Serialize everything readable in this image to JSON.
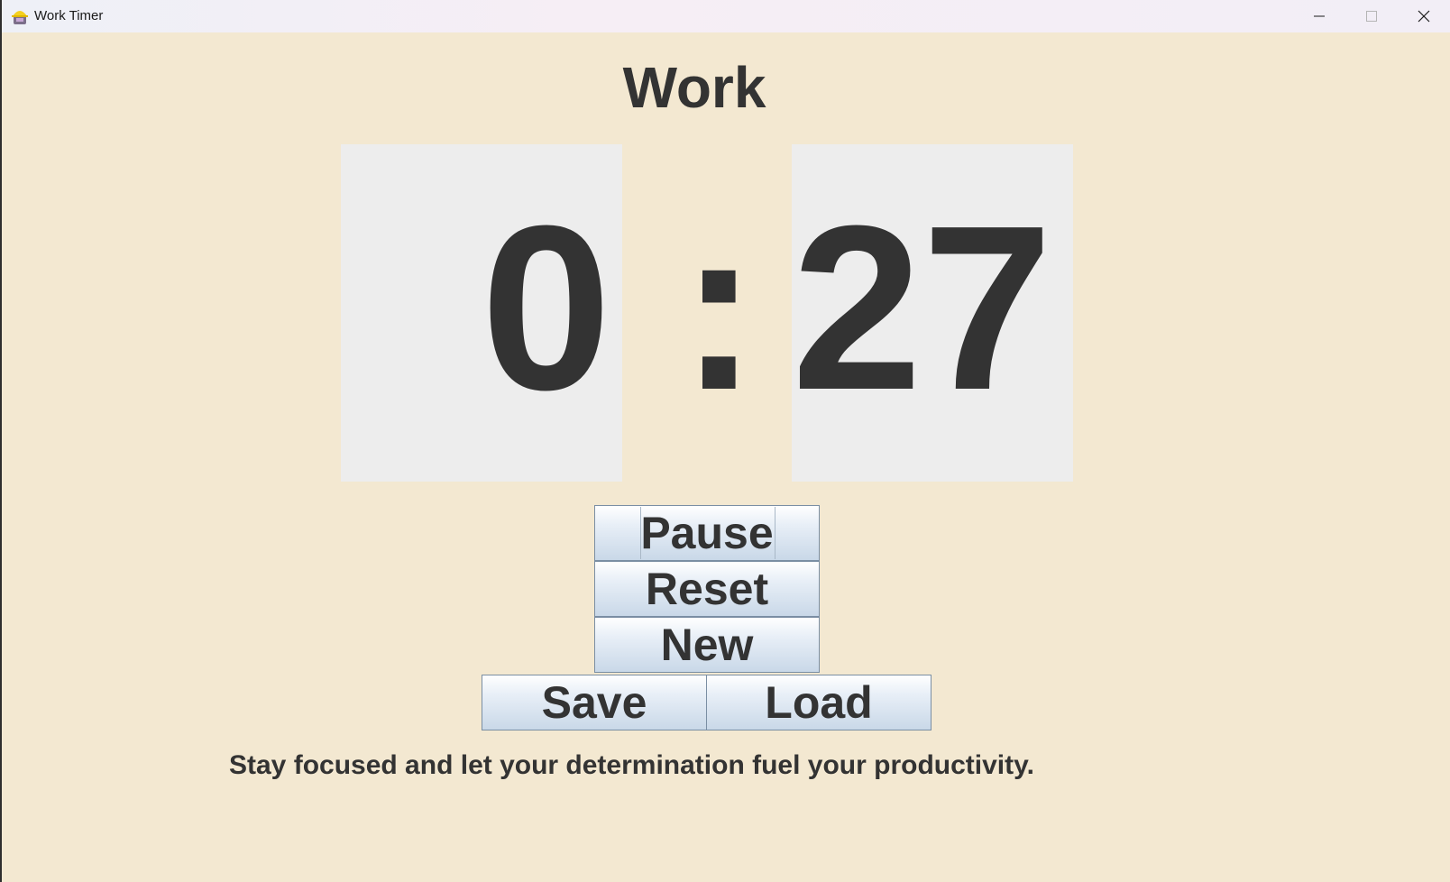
{
  "window": {
    "title": "Work Timer",
    "icon": "hardhat-app-icon",
    "controls": [
      "minimize-icon",
      "maximize-icon",
      "close-icon"
    ]
  },
  "timer": {
    "mode": "Work",
    "minutes": "0",
    "separator": ":",
    "seconds": "27"
  },
  "buttons": {
    "pause": "Pause",
    "reset": "Reset",
    "new": "New",
    "save": "Save",
    "load": "Load"
  },
  "message": "Stay focused and let your determination fuel your productivity.",
  "colors": {
    "background": "#f3e8d1",
    "panel": "#ededed",
    "text": "#333333",
    "button_top": "#ffffff",
    "button_bottom": "#c9d8e8"
  }
}
